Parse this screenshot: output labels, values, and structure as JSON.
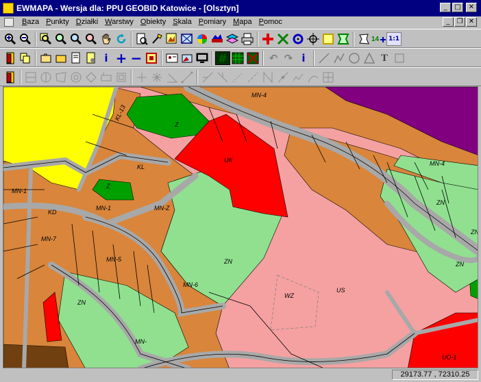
{
  "window": {
    "title": "EWMAPA - Wersja dla: PPU GEOBID Katowice - [Olsztyn]",
    "controls": {
      "minimize": "_",
      "maximize": "□",
      "close": "✕"
    }
  },
  "menu": {
    "items": [
      "Baza",
      "Punkty",
      "Działki",
      "Warstwy",
      "Obiekty",
      "Skala",
      "Pomiary",
      "Mapa",
      "Pomoc"
    ],
    "mdi_controls": {
      "minimize": "_",
      "restore": "❐",
      "close": "✕"
    }
  },
  "toolbar": {
    "info_label": "i",
    "plus_label": "+",
    "minus_label": "−",
    "text_label": "T",
    "scale_label": "1:1",
    "grid_label": "#",
    "label_14": "14"
  },
  "map": {
    "zones": [
      {
        "label": "MN-4"
      },
      {
        "label": "Z"
      },
      {
        "label": "UK"
      },
      {
        "label": "MN-4"
      },
      {
        "label": "ZN"
      },
      {
        "label": "MN-Z"
      },
      {
        "label": "Z"
      },
      {
        "label": "MN-1"
      },
      {
        "label": "MN-7"
      },
      {
        "label": "MN-5"
      },
      {
        "label": "ZN"
      },
      {
        "label": "MN-6"
      },
      {
        "label": "WZ"
      },
      {
        "label": "US"
      },
      {
        "label": "ZN"
      },
      {
        "label": "ZN"
      },
      {
        "label": "ZN"
      },
      {
        "label": "MN-"
      },
      {
        "label": "UO-1"
      },
      {
        "label": "MN-1"
      },
      {
        "label": "KL"
      },
      {
        "label": "KD"
      },
      {
        "label": "KL-13"
      }
    ],
    "colors": {
      "residential": "#d9853b",
      "green": "#00a000",
      "green_light": "#90e090",
      "service_red": "#ff0000",
      "sport_pink": "#f5a1a1",
      "yellow": "#ffff00",
      "purple": "#800080",
      "road": "#a8a8a8",
      "brown": "#704010"
    }
  },
  "status": {
    "coordinates": "29173.77 , 72310.25"
  }
}
